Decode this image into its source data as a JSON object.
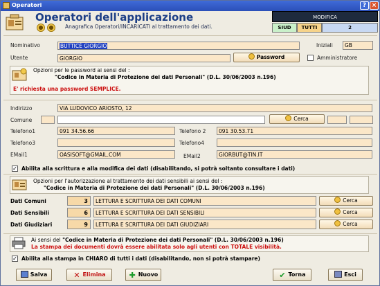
{
  "window": {
    "title": "Operatori"
  },
  "header": {
    "title": "Operatori dell'applicazione",
    "subtitle": "Anagrafica Operatori/INCARICATI al trattamento dei dati.",
    "mode": "MODIFICA",
    "siud": "SIUD",
    "tutti": "TUTTI",
    "count": "2"
  },
  "form": {
    "nominativo_label": "Nominativo",
    "nominativo_value": "BUTTICÈ GIORGIO",
    "iniziali_label": "Iniziali",
    "iniziali_value": "GB",
    "utente_label": "Utente",
    "utente_value": "GIORGIO",
    "password_button": "Password",
    "amministratore_label": "Amministratore",
    "pw_opzioni": "Opzioni per le password ai sensi del :",
    "pw_codice": "\"Codice in Materia di Protezione dei dati Personali\" (D.L. 30/06/2003 n.196)",
    "pw_required": "E' richiesta una password SEMPLICE.",
    "indirizzo_label": "Indirizzo",
    "indirizzo_value": "VIA LUDOVICO ARIOSTO, 12",
    "comune_label": "Comune",
    "comune_value": "",
    "cerca": "Cerca",
    "telefono1_label": "Telefono1",
    "telefono1_value": "091 34.56.66",
    "telefono2_label": "Telefono 2",
    "telefono2_value": "091 30.53.71",
    "telefono3_label": "Telefono3",
    "telefono3_value": "",
    "telefono4_label": "Telefono4",
    "telefono4_value": "",
    "email1_label": "EMail1",
    "email1_value": "OASISOFT@GMAIL.COM",
    "email2_label": "EMail2",
    "email2_value": "GIORBUT@TIN.IT"
  },
  "abilita_scrittura": "Abilita alla scrittura e alla modifica dei dati (disabilitando, si potrà soltanto consultare i dati)",
  "auth": {
    "opzioni": "Opzioni per l'autorizzazione al trattamento dei dati sensibili ai sensi del :",
    "codice": "\"Codice in Materia di Protezione dei dati Personali\" (D.L. 30/06/2003 n.196)",
    "rows": [
      {
        "label": "Dati Comuni",
        "num": "3",
        "value": "LETTURA E SCRITTURA DEI DATI COMUNI",
        "cerca": "Cerca"
      },
      {
        "label": "Dati Sensibili",
        "num": "6",
        "value": "LETTURA E SCRITTURA DEI DATI SENSIBILI",
        "cerca": "Cerca"
      },
      {
        "label": "Dati Giudiziari",
        "num": "9",
        "value": "LETTURA E SCRITTURA DEI DATI GIUDIZIARI",
        "cerca": "Cerca"
      }
    ]
  },
  "stampa": {
    "prefix": "Ai sensi del ",
    "codice": "\"Codice in Materia di Protezione dei dati Personali\"",
    "suffix": " (D.L. 30/06/2003 n.196)",
    "warning": "La stampa dei documenti dovrà essere abilitata solo agli utenti con TOTALE visibilità."
  },
  "abilita_stampa": "Abilita alla stampa in CHIARO di tutti i dati (disabilitando, non si potrà stampare)",
  "footer": {
    "salva": "Salva",
    "elimina": "Elimina",
    "nuovo": "Nuovo",
    "torna": "Torna",
    "esci": "Esci"
  }
}
